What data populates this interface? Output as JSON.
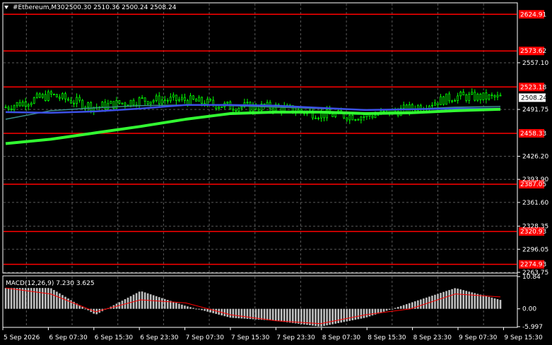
{
  "header": {
    "symbol_timeframe": "#Ethereum,M30",
    "ohlc": "2500.30 2510.36 2500.24 2508.24"
  },
  "price_axis": {
    "ticks": [
      "2557.10",
      "2491.75",
      "2426.20",
      "2393.90",
      "2361.60",
      "2328.35",
      "2296.05",
      "2263.75"
    ],
    "current_price": "2508.24"
  },
  "levels": [
    {
      "label": "2624.91",
      "value": 2624.91
    },
    {
      "label": "2573.62",
      "value": 2573.62
    },
    {
      "label": "2523.18",
      "value": 2523.18
    },
    {
      "label": "2458.33",
      "value": 2458.33
    },
    {
      "label": "2387.05",
      "value": 2387.05
    },
    {
      "label": "2320.93",
      "value": 2320.93
    },
    {
      "label": "2274.93",
      "value": 2274.93
    }
  ],
  "macd": {
    "label": "MACD(12,26,9) 7.230 3.625",
    "axis_ticks": [
      "10.84",
      "0.00",
      "-5.997"
    ]
  },
  "time_axis": [
    "5 Sep 2026",
    "6 Sep 07:30",
    "6 Sep 15:30",
    "6 Sep 23:30",
    "7 Sep 07:30",
    "7 Sep 15:30",
    "7 Sep 23:30",
    "8 Sep 07:30",
    "8 Sep 15:30",
    "8 Sep 23:30",
    "9 Sep 07:30",
    "9 Sep 15:30"
  ],
  "colors": {
    "background": "#000000",
    "candle": "#00ff00",
    "level_line": "#ff0000",
    "ma_fast": "#3c8c8c",
    "ma_mid": "#3c50e6",
    "ma_slow": "#32ff32",
    "macd_hist": "#c0c0c0",
    "macd_signal": "#ff0000",
    "grid": "#5a5a5a"
  },
  "chart_data": {
    "type": "candlestick",
    "title": "#Ethereum,M30",
    "ylim": [
      2263.75,
      2640
    ],
    "x": [
      "5 Sep 2026",
      "6 Sep 07:30",
      "6 Sep 15:30",
      "6 Sep 23:30",
      "7 Sep 07:30",
      "7 Sep 15:30",
      "7 Sep 23:30",
      "8 Sep 07:30",
      "8 Sep 15:30",
      "8 Sep 23:30",
      "9 Sep 07:30",
      "9 Sep 15:30"
    ],
    "close_approx": [
      2495,
      2512,
      2495,
      2505,
      2505,
      2496,
      2495,
      2485,
      2482,
      2493,
      2510,
      2508
    ],
    "moving_averages": [
      {
        "color": "#3c8c8c",
        "values": [
          2478,
          2490,
          2494,
          2497,
          2498,
          2497,
          2495,
          2493,
          2491,
          2492,
          2495,
          2496
        ]
      },
      {
        "color": "#3c50e6",
        "values": [
          2488,
          2487,
          2489,
          2493,
          2498,
          2498,
          2497,
          2494,
          2491,
          2492,
          2493,
          2493
        ]
      },
      {
        "color": "#32ff32",
        "values": [
          2444,
          2450,
          2459,
          2468,
          2478,
          2486,
          2488,
          2488,
          2486,
          2487,
          2490,
          2492
        ]
      }
    ],
    "macd": {
      "histogram": [
        7,
        7,
        -2,
        6,
        1,
        -3,
        -4,
        -6,
        -3,
        2,
        7,
        3
      ],
      "signal": [
        7,
        5,
        -1,
        3,
        2,
        -2,
        -4,
        -5,
        -2,
        0,
        5,
        4
      ]
    }
  }
}
